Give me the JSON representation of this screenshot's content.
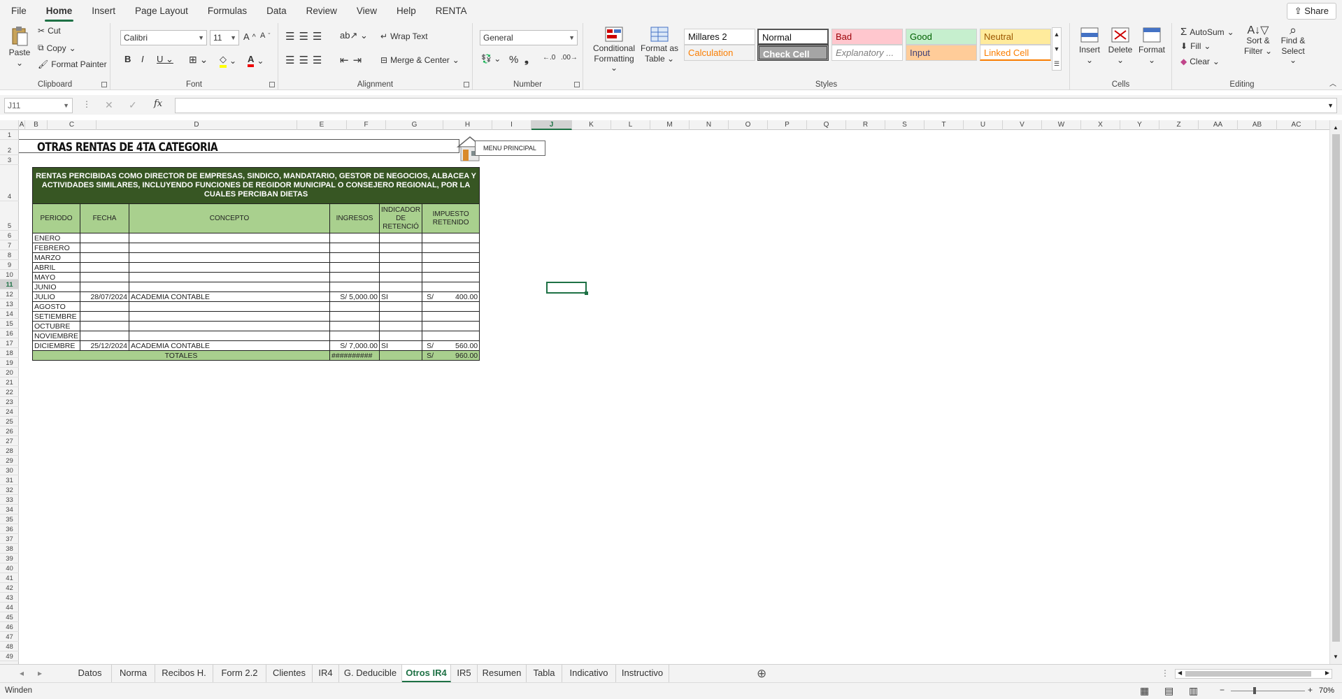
{
  "menu": {
    "items": [
      "File",
      "Home",
      "Insert",
      "Page Layout",
      "Formulas",
      "Data",
      "Review",
      "View",
      "Help",
      "RENTA"
    ],
    "share": "Share"
  },
  "ribbon": {
    "clipboard": {
      "label": "Clipboard",
      "paste": "Paste",
      "cut": "Cut",
      "copy": "Copy",
      "format_painter": "Format Painter"
    },
    "font": {
      "label": "Font",
      "name": "Calibri",
      "size": "11"
    },
    "alignment": {
      "label": "Alignment",
      "wrap": "Wrap Text",
      "merge": "Merge & Center"
    },
    "number": {
      "label": "Number",
      "format": "General"
    },
    "styles": {
      "label": "Styles",
      "conditional": [
        "Conditional",
        "Formatting"
      ],
      "format_table": [
        "Format as",
        "Table"
      ],
      "cells": [
        {
          "text": "Millares 2",
          "bg": "#ffffff",
          "fg": "#111111"
        },
        {
          "text": "Normal",
          "bg": "#ffffff",
          "fg": "#111111"
        },
        {
          "text": "Bad",
          "bg": "#ffc7ce",
          "fg": "#9c0006"
        },
        {
          "text": "Good",
          "bg": "#c6efce",
          "fg": "#006100"
        },
        {
          "text": "Neutral",
          "bg": "#ffeb9c",
          "fg": "#9c5700"
        },
        {
          "text": "Calculation",
          "bg": "#f2f2f2",
          "fg": "#fa7d00"
        },
        {
          "text": "Check Cell",
          "bg": "#a5a5a5",
          "fg": "#ffffff"
        },
        {
          "text": "Explanatory ...",
          "bg": "#ffffff",
          "fg": "#7f7f7f"
        },
        {
          "text": "Input",
          "bg": "#ffcc99",
          "fg": "#3f3f76"
        },
        {
          "text": "Linked Cell",
          "bg": "#ffffff",
          "fg": "#fa7d00"
        }
      ]
    },
    "cells": {
      "label": "Cells",
      "insert": "Insert",
      "delete": "Delete",
      "format": "Format"
    },
    "editing": {
      "label": "Editing",
      "autosum": "AutoSum",
      "fill": "Fill",
      "clear": "Clear",
      "sort": [
        "Sort &",
        "Filter"
      ],
      "find": [
        "Find &",
        "Select"
      ]
    }
  },
  "formula_bar": {
    "name_box": "J11",
    "fx": "fx"
  },
  "columns": [
    "A",
    "B",
    "C",
    "D",
    "E",
    "F",
    "G",
    "H",
    "I",
    "J",
    "K",
    "L",
    "M",
    "N",
    "O",
    "P",
    "Q",
    "R",
    "S",
    "T",
    "U",
    "V",
    "W",
    "X",
    "Y",
    "Z",
    "AA",
    "AB",
    "AC"
  ],
  "selected_column": "J",
  "selected_row": 11,
  "sheet": {
    "title": "OTRAS RENTAS DE 4TA CATEGORIA",
    "menu_button": "MENU PRINCIPAL",
    "header": "RENTAS PERCIBIDAS COMO DIRECTOR DE EMPRESAS, SINDICO, MANDATARIO, GESTOR DE NEGOCIOS, ALBACEA Y ACTIVIDADES SIMILARES, INCLUYENDO FUNCIONES DE REGIDOR MUNICIPAL O CONSEJERO REGIONAL, POR LA CUALES PERCIBAN DIETAS",
    "columns": [
      "PERIODO",
      "FECHA",
      "CONCEPTO",
      "INGRESOS",
      "INDICADOR DE RETENCIÓ",
      "IMPUESTO RETENIDO"
    ],
    "rows": [
      {
        "periodo": "ENERO",
        "fecha": "",
        "concepto": "",
        "ingresos": "",
        "indicador": "",
        "imp_cur": "",
        "imp": ""
      },
      {
        "periodo": "FEBRERO",
        "fecha": "",
        "concepto": "",
        "ingresos": "",
        "indicador": "",
        "imp_cur": "",
        "imp": ""
      },
      {
        "periodo": "MARZO",
        "fecha": "",
        "concepto": "",
        "ingresos": "",
        "indicador": "",
        "imp_cur": "",
        "imp": ""
      },
      {
        "periodo": "ABRIL",
        "fecha": "",
        "concepto": "",
        "ingresos": "",
        "indicador": "",
        "imp_cur": "",
        "imp": ""
      },
      {
        "periodo": "MAYO",
        "fecha": "",
        "concepto": "",
        "ingresos": "",
        "indicador": "",
        "imp_cur": "",
        "imp": ""
      },
      {
        "periodo": "JUNIO",
        "fecha": "",
        "concepto": "",
        "ingresos": "",
        "indicador": "",
        "imp_cur": "",
        "imp": ""
      },
      {
        "periodo": "JULIO",
        "fecha": "28/07/2024",
        "concepto": "ACADEMIA CONTABLE",
        "ingresos": "S/ 5,000.00",
        "indicador": "SI",
        "imp_cur": "S/",
        "imp": "400.00"
      },
      {
        "periodo": "AGOSTO",
        "fecha": "",
        "concepto": "",
        "ingresos": "",
        "indicador": "",
        "imp_cur": "",
        "imp": ""
      },
      {
        "periodo": "SETIEMBRE",
        "fecha": "",
        "concepto": "",
        "ingresos": "",
        "indicador": "",
        "imp_cur": "",
        "imp": ""
      },
      {
        "periodo": "OCTUBRE",
        "fecha": "",
        "concepto": "",
        "ingresos": "",
        "indicador": "",
        "imp_cur": "",
        "imp": ""
      },
      {
        "periodo": "NOVIEMBRE",
        "fecha": "",
        "concepto": "",
        "ingresos": "",
        "indicador": "",
        "imp_cur": "",
        "imp": ""
      },
      {
        "periodo": "DICIEMBRE",
        "fecha": "25/12/2024",
        "concepto": "ACADEMIA CONTABLE",
        "ingresos": "S/ 7,000.00",
        "indicador": "SI",
        "imp_cur": "S/",
        "imp": "560.00"
      }
    ],
    "totals": {
      "label": "TOTALES",
      "ingresos": "##########",
      "imp_cur": "S/",
      "imp": "960.00"
    }
  },
  "tabs": [
    "Datos",
    "Norma",
    "Recibos H.",
    "Form 2.2",
    "Clientes",
    "IR4",
    "G. Deducible",
    "Otros IR4",
    "IR5",
    "Resumen",
    "Tabla",
    "Indicativo",
    "Instructivo"
  ],
  "active_tab": "Otros IR4",
  "status": {
    "text": "Winden",
    "zoom": "70%"
  }
}
